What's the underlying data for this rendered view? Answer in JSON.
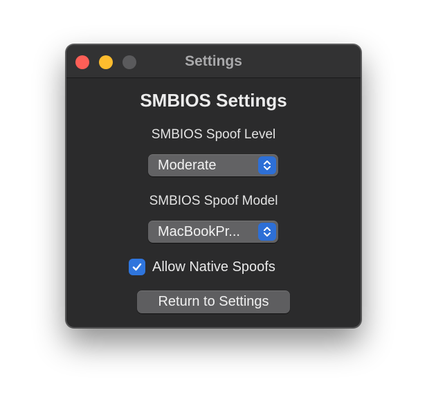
{
  "window": {
    "title": "Settings",
    "heading": "SMBIOS Settings"
  },
  "spoof_level": {
    "label": "SMBIOS Spoof Level",
    "selected": "Moderate"
  },
  "spoof_model": {
    "label": "SMBIOS Spoof Model",
    "selected": "MacBookPr..."
  },
  "native_spoofs": {
    "label": "Allow Native Spoofs",
    "checked": true
  },
  "return_button": {
    "label": "Return to Settings"
  },
  "colors": {
    "accent": "#2f75dd",
    "close": "#fe5f57",
    "minimize": "#febc2e",
    "window_bg": "#2b2b2c"
  },
  "icons": {
    "popup_stepper": "chevron-up-down-icon",
    "checkbox": "checkmark-icon"
  }
}
